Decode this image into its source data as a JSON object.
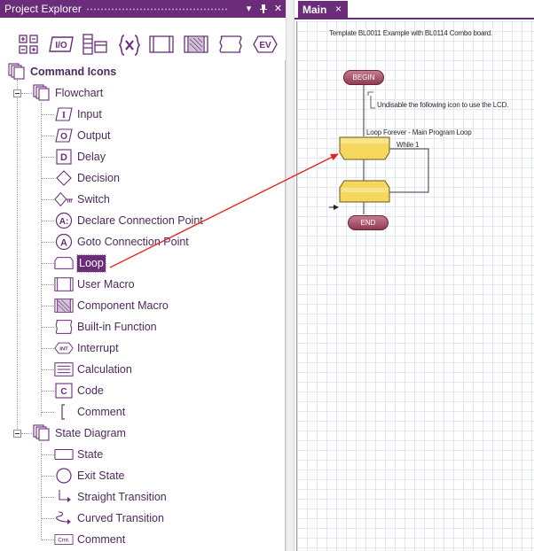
{
  "explorer": {
    "title": "Project Explorer",
    "toolbar_icons": [
      "command-icons",
      "io-icon",
      "components-icon",
      "variables-icon",
      "macros-icon",
      "component-macros-icon",
      "builtin-functions-icon",
      "events-icon"
    ],
    "io_text": "I/O",
    "ev_text": "EV",
    "root": {
      "label": "Command Icons"
    },
    "flowchart": {
      "label": "Flowchart",
      "items": [
        {
          "label": "Input",
          "icon": "input-icon"
        },
        {
          "label": "Output",
          "icon": "output-icon"
        },
        {
          "label": "Delay",
          "icon": "delay-icon"
        },
        {
          "label": "Decision",
          "icon": "decision-icon"
        },
        {
          "label": "Switch",
          "icon": "switch-icon"
        },
        {
          "label": "Declare Connection Point",
          "icon": "declare-connection-point-icon"
        },
        {
          "label": "Goto Connection Point",
          "icon": "goto-connection-point-icon"
        },
        {
          "label": "Loop",
          "icon": "loop-icon",
          "selected": true
        },
        {
          "label": "User Macro",
          "icon": "user-macro-icon"
        },
        {
          "label": "Component Macro",
          "icon": "component-macro-icon"
        },
        {
          "label": "Built-in Function",
          "icon": "builtin-function-icon"
        },
        {
          "label": "Interrupt",
          "icon": "interrupt-icon"
        },
        {
          "label": "Calculation",
          "icon": "calculation-icon"
        },
        {
          "label": "Code",
          "icon": "code-icon"
        },
        {
          "label": "Comment",
          "icon": "comment-icon"
        }
      ]
    },
    "state_diagram": {
      "label": "State Diagram",
      "items": [
        {
          "label": "State",
          "icon": "state-icon"
        },
        {
          "label": "Exit State",
          "icon": "exit-state-icon"
        },
        {
          "label": "Straight Transition",
          "icon": "straight-transition-icon"
        },
        {
          "label": "Curved Transition",
          "icon": "curved-transition-icon"
        },
        {
          "label": "Comment",
          "icon": "state-comment-icon"
        }
      ]
    },
    "glyphs": {
      "input": "I",
      "output": "O",
      "delay": "D",
      "declare": "A:",
      "goto": "A",
      "interrupt": "INT",
      "code": "C",
      "state_comment": "Cmt."
    }
  },
  "document": {
    "tab_label": "Main",
    "tab_close": "×",
    "template_text": "Template BL0011 Example with BL0114 Combo board.",
    "begin_label": "BEGIN",
    "end_label": "END",
    "comment_text": "Undisable the following icon to use the LCD.",
    "loop_title": "Loop Forever - Main Program Loop",
    "loop_condition": "While 1"
  },
  "colors": {
    "accent": "#6b2c7a",
    "icon": "#6b2c7a",
    "terminator": "#a04a62",
    "loop_fill": "#f5d75e",
    "arrow": "#e8221e"
  }
}
